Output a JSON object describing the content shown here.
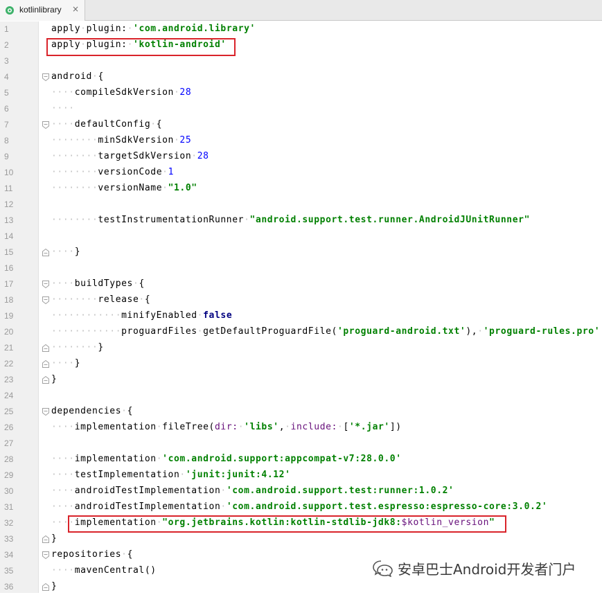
{
  "tab": {
    "label": "kotlinlibrary",
    "close": "×",
    "icon": "gradle-module-icon"
  },
  "lines": [
    {
      "n": "1",
      "tokens": [
        {
          "t": "apply",
          "c": "plain"
        },
        {
          "t": "·",
          "c": "ws"
        },
        {
          "t": "plugin:",
          "c": "plain"
        },
        {
          "t": "·",
          "c": "ws"
        },
        {
          "t": "'com.android.library'",
          "c": "str"
        }
      ]
    },
    {
      "n": "2",
      "tokens": [
        {
          "t": "apply",
          "c": "plain"
        },
        {
          "t": "·",
          "c": "ws"
        },
        {
          "t": "plugin:",
          "c": "plain"
        },
        {
          "t": "·",
          "c": "ws"
        },
        {
          "t": "'kotlin-android'",
          "c": "str"
        }
      ]
    },
    {
      "n": "3",
      "tokens": []
    },
    {
      "n": "4",
      "fold": "open",
      "tokens": [
        {
          "t": "android",
          "c": "plain"
        },
        {
          "t": "·",
          "c": "ws"
        },
        {
          "t": "{",
          "c": "brace"
        }
      ]
    },
    {
      "n": "5",
      "tokens": [
        {
          "t": "····",
          "c": "ws"
        },
        {
          "t": "compileSdkVersion",
          "c": "plain"
        },
        {
          "t": "·",
          "c": "ws"
        },
        {
          "t": "28",
          "c": "num"
        }
      ]
    },
    {
      "n": "6",
      "tokens": [
        {
          "t": "····",
          "c": "ws"
        }
      ]
    },
    {
      "n": "7",
      "fold": "open",
      "tokens": [
        {
          "t": "····",
          "c": "ws"
        },
        {
          "t": "defaultConfig",
          "c": "plain"
        },
        {
          "t": "·",
          "c": "ws"
        },
        {
          "t": "{",
          "c": "brace"
        }
      ]
    },
    {
      "n": "8",
      "tokens": [
        {
          "t": "········",
          "c": "ws"
        },
        {
          "t": "minSdkVersion",
          "c": "plain"
        },
        {
          "t": "·",
          "c": "ws"
        },
        {
          "t": "25",
          "c": "num"
        }
      ]
    },
    {
      "n": "9",
      "tokens": [
        {
          "t": "········",
          "c": "ws"
        },
        {
          "t": "targetSdkVersion",
          "c": "plain"
        },
        {
          "t": "·",
          "c": "ws"
        },
        {
          "t": "28",
          "c": "num"
        }
      ]
    },
    {
      "n": "10",
      "tokens": [
        {
          "t": "········",
          "c": "ws"
        },
        {
          "t": "versionCode",
          "c": "plain"
        },
        {
          "t": "·",
          "c": "ws"
        },
        {
          "t": "1",
          "c": "num"
        }
      ]
    },
    {
      "n": "11",
      "tokens": [
        {
          "t": "········",
          "c": "ws"
        },
        {
          "t": "versionName",
          "c": "plain"
        },
        {
          "t": "·",
          "c": "ws"
        },
        {
          "t": "\"1.0\"",
          "c": "str"
        }
      ]
    },
    {
      "n": "12",
      "tokens": []
    },
    {
      "n": "13",
      "tokens": [
        {
          "t": "········",
          "c": "ws"
        },
        {
          "t": "testInstrumentationRunner",
          "c": "plain"
        },
        {
          "t": "·",
          "c": "ws"
        },
        {
          "t": "\"android.support.test.runner.AndroidJUnitRunner\"",
          "c": "str"
        }
      ]
    },
    {
      "n": "14",
      "tokens": []
    },
    {
      "n": "15",
      "fold": "close",
      "tokens": [
        {
          "t": "····",
          "c": "ws"
        },
        {
          "t": "}",
          "c": "brace"
        }
      ]
    },
    {
      "n": "16",
      "tokens": []
    },
    {
      "n": "17",
      "fold": "open",
      "tokens": [
        {
          "t": "····",
          "c": "ws"
        },
        {
          "t": "buildTypes",
          "c": "plain"
        },
        {
          "t": "·",
          "c": "ws"
        },
        {
          "t": "{",
          "c": "brace"
        }
      ]
    },
    {
      "n": "18",
      "fold": "open",
      "tokens": [
        {
          "t": "········",
          "c": "ws"
        },
        {
          "t": "release",
          "c": "plain"
        },
        {
          "t": "·",
          "c": "ws"
        },
        {
          "t": "{",
          "c": "brace"
        }
      ]
    },
    {
      "n": "19",
      "tokens": [
        {
          "t": "············",
          "c": "ws"
        },
        {
          "t": "minifyEnabled",
          "c": "plain"
        },
        {
          "t": "·",
          "c": "ws"
        },
        {
          "t": "false",
          "c": "kw"
        }
      ]
    },
    {
      "n": "20",
      "tokens": [
        {
          "t": "············",
          "c": "ws"
        },
        {
          "t": "proguardFiles",
          "c": "plain"
        },
        {
          "t": "·",
          "c": "ws"
        },
        {
          "t": "getDefaultProguardFile(",
          "c": "plain"
        },
        {
          "t": "'proguard-android.txt'",
          "c": "str"
        },
        {
          "t": "),",
          "c": "plain"
        },
        {
          "t": "·",
          "c": "ws"
        },
        {
          "t": "'proguard-rules.pro'",
          "c": "str"
        }
      ]
    },
    {
      "n": "21",
      "fold": "close",
      "tokens": [
        {
          "t": "········",
          "c": "ws"
        },
        {
          "t": "}",
          "c": "brace"
        }
      ]
    },
    {
      "n": "22",
      "fold": "close",
      "tokens": [
        {
          "t": "····",
          "c": "ws"
        },
        {
          "t": "}",
          "c": "brace"
        }
      ]
    },
    {
      "n": "23",
      "fold": "close",
      "tokens": [
        {
          "t": "}",
          "c": "brace"
        }
      ]
    },
    {
      "n": "24",
      "tokens": []
    },
    {
      "n": "25",
      "fold": "open",
      "tokens": [
        {
          "t": "dependencies",
          "c": "plain"
        },
        {
          "t": "·",
          "c": "ws"
        },
        {
          "t": "{",
          "c": "brace"
        }
      ]
    },
    {
      "n": "26",
      "tokens": [
        {
          "t": "····",
          "c": "ws"
        },
        {
          "t": "implementation",
          "c": "plain"
        },
        {
          "t": "·",
          "c": "ws"
        },
        {
          "t": "fileTree(",
          "c": "plain"
        },
        {
          "t": "dir:",
          "c": "label"
        },
        {
          "t": "·",
          "c": "ws"
        },
        {
          "t": "'libs'",
          "c": "str"
        },
        {
          "t": ",",
          "c": "plain"
        },
        {
          "t": "·",
          "c": "ws"
        },
        {
          "t": "include:",
          "c": "label"
        },
        {
          "t": "·",
          "c": "ws"
        },
        {
          "t": "[",
          "c": "plain"
        },
        {
          "t": "'*.jar'",
          "c": "str"
        },
        {
          "t": "])",
          "c": "plain"
        }
      ]
    },
    {
      "n": "27",
      "tokens": []
    },
    {
      "n": "28",
      "tokens": [
        {
          "t": "····",
          "c": "ws"
        },
        {
          "t": "implementation",
          "c": "plain"
        },
        {
          "t": "·",
          "c": "ws"
        },
        {
          "t": "'com.android.support:appcompat-v7:28.0.0'",
          "c": "str"
        }
      ]
    },
    {
      "n": "29",
      "tokens": [
        {
          "t": "····",
          "c": "ws"
        },
        {
          "t": "testImplementation",
          "c": "plain"
        },
        {
          "t": "·",
          "c": "ws"
        },
        {
          "t": "'junit:junit:4.12'",
          "c": "str"
        }
      ]
    },
    {
      "n": "30",
      "tokens": [
        {
          "t": "····",
          "c": "ws"
        },
        {
          "t": "androidTestImplementation",
          "c": "plain"
        },
        {
          "t": "·",
          "c": "ws"
        },
        {
          "t": "'com.android.support.test:runner:1.0.2'",
          "c": "str"
        }
      ]
    },
    {
      "n": "31",
      "tokens": [
        {
          "t": "····",
          "c": "ws"
        },
        {
          "t": "androidTestImplementation",
          "c": "plain"
        },
        {
          "t": "·",
          "c": "ws"
        },
        {
          "t": "'com.android.support.test.espresso:espresso-core:3.0.2'",
          "c": "str"
        }
      ]
    },
    {
      "n": "32",
      "tokens": [
        {
          "t": "····",
          "c": "ws"
        },
        {
          "t": "implementation",
          "c": "plain"
        },
        {
          "t": "·",
          "c": "ws"
        },
        {
          "t": "\"org.jetbrains.kotlin:kotlin-stdlib-jdk8:",
          "c": "str"
        },
        {
          "t": "$kotlin_version",
          "c": "var"
        },
        {
          "t": "\"",
          "c": "str"
        }
      ]
    },
    {
      "n": "33",
      "fold": "close",
      "tokens": [
        {
          "t": "}",
          "c": "brace"
        }
      ]
    },
    {
      "n": "34",
      "fold": "open",
      "tokens": [
        {
          "t": "repositories",
          "c": "plain"
        },
        {
          "t": "·",
          "c": "ws"
        },
        {
          "t": "{",
          "c": "brace"
        }
      ]
    },
    {
      "n": "35",
      "tokens": [
        {
          "t": "····",
          "c": "ws"
        },
        {
          "t": "mavenCentral()",
          "c": "plain"
        }
      ]
    },
    {
      "n": "36",
      "fold": "close",
      "tokens": [
        {
          "t": "}",
          "c": "brace"
        }
      ]
    }
  ],
  "highlights": [
    "line-2-kotlin-android",
    "line-32-kotlin-stdlib"
  ],
  "watermark": {
    "text": "安卓巴士Android开发者门户",
    "icon": "wechat-official-account-icon"
  },
  "colors": {
    "string": "#008000",
    "number": "#0000ff",
    "keyword": "#000080",
    "highlight": "#d9232a"
  }
}
